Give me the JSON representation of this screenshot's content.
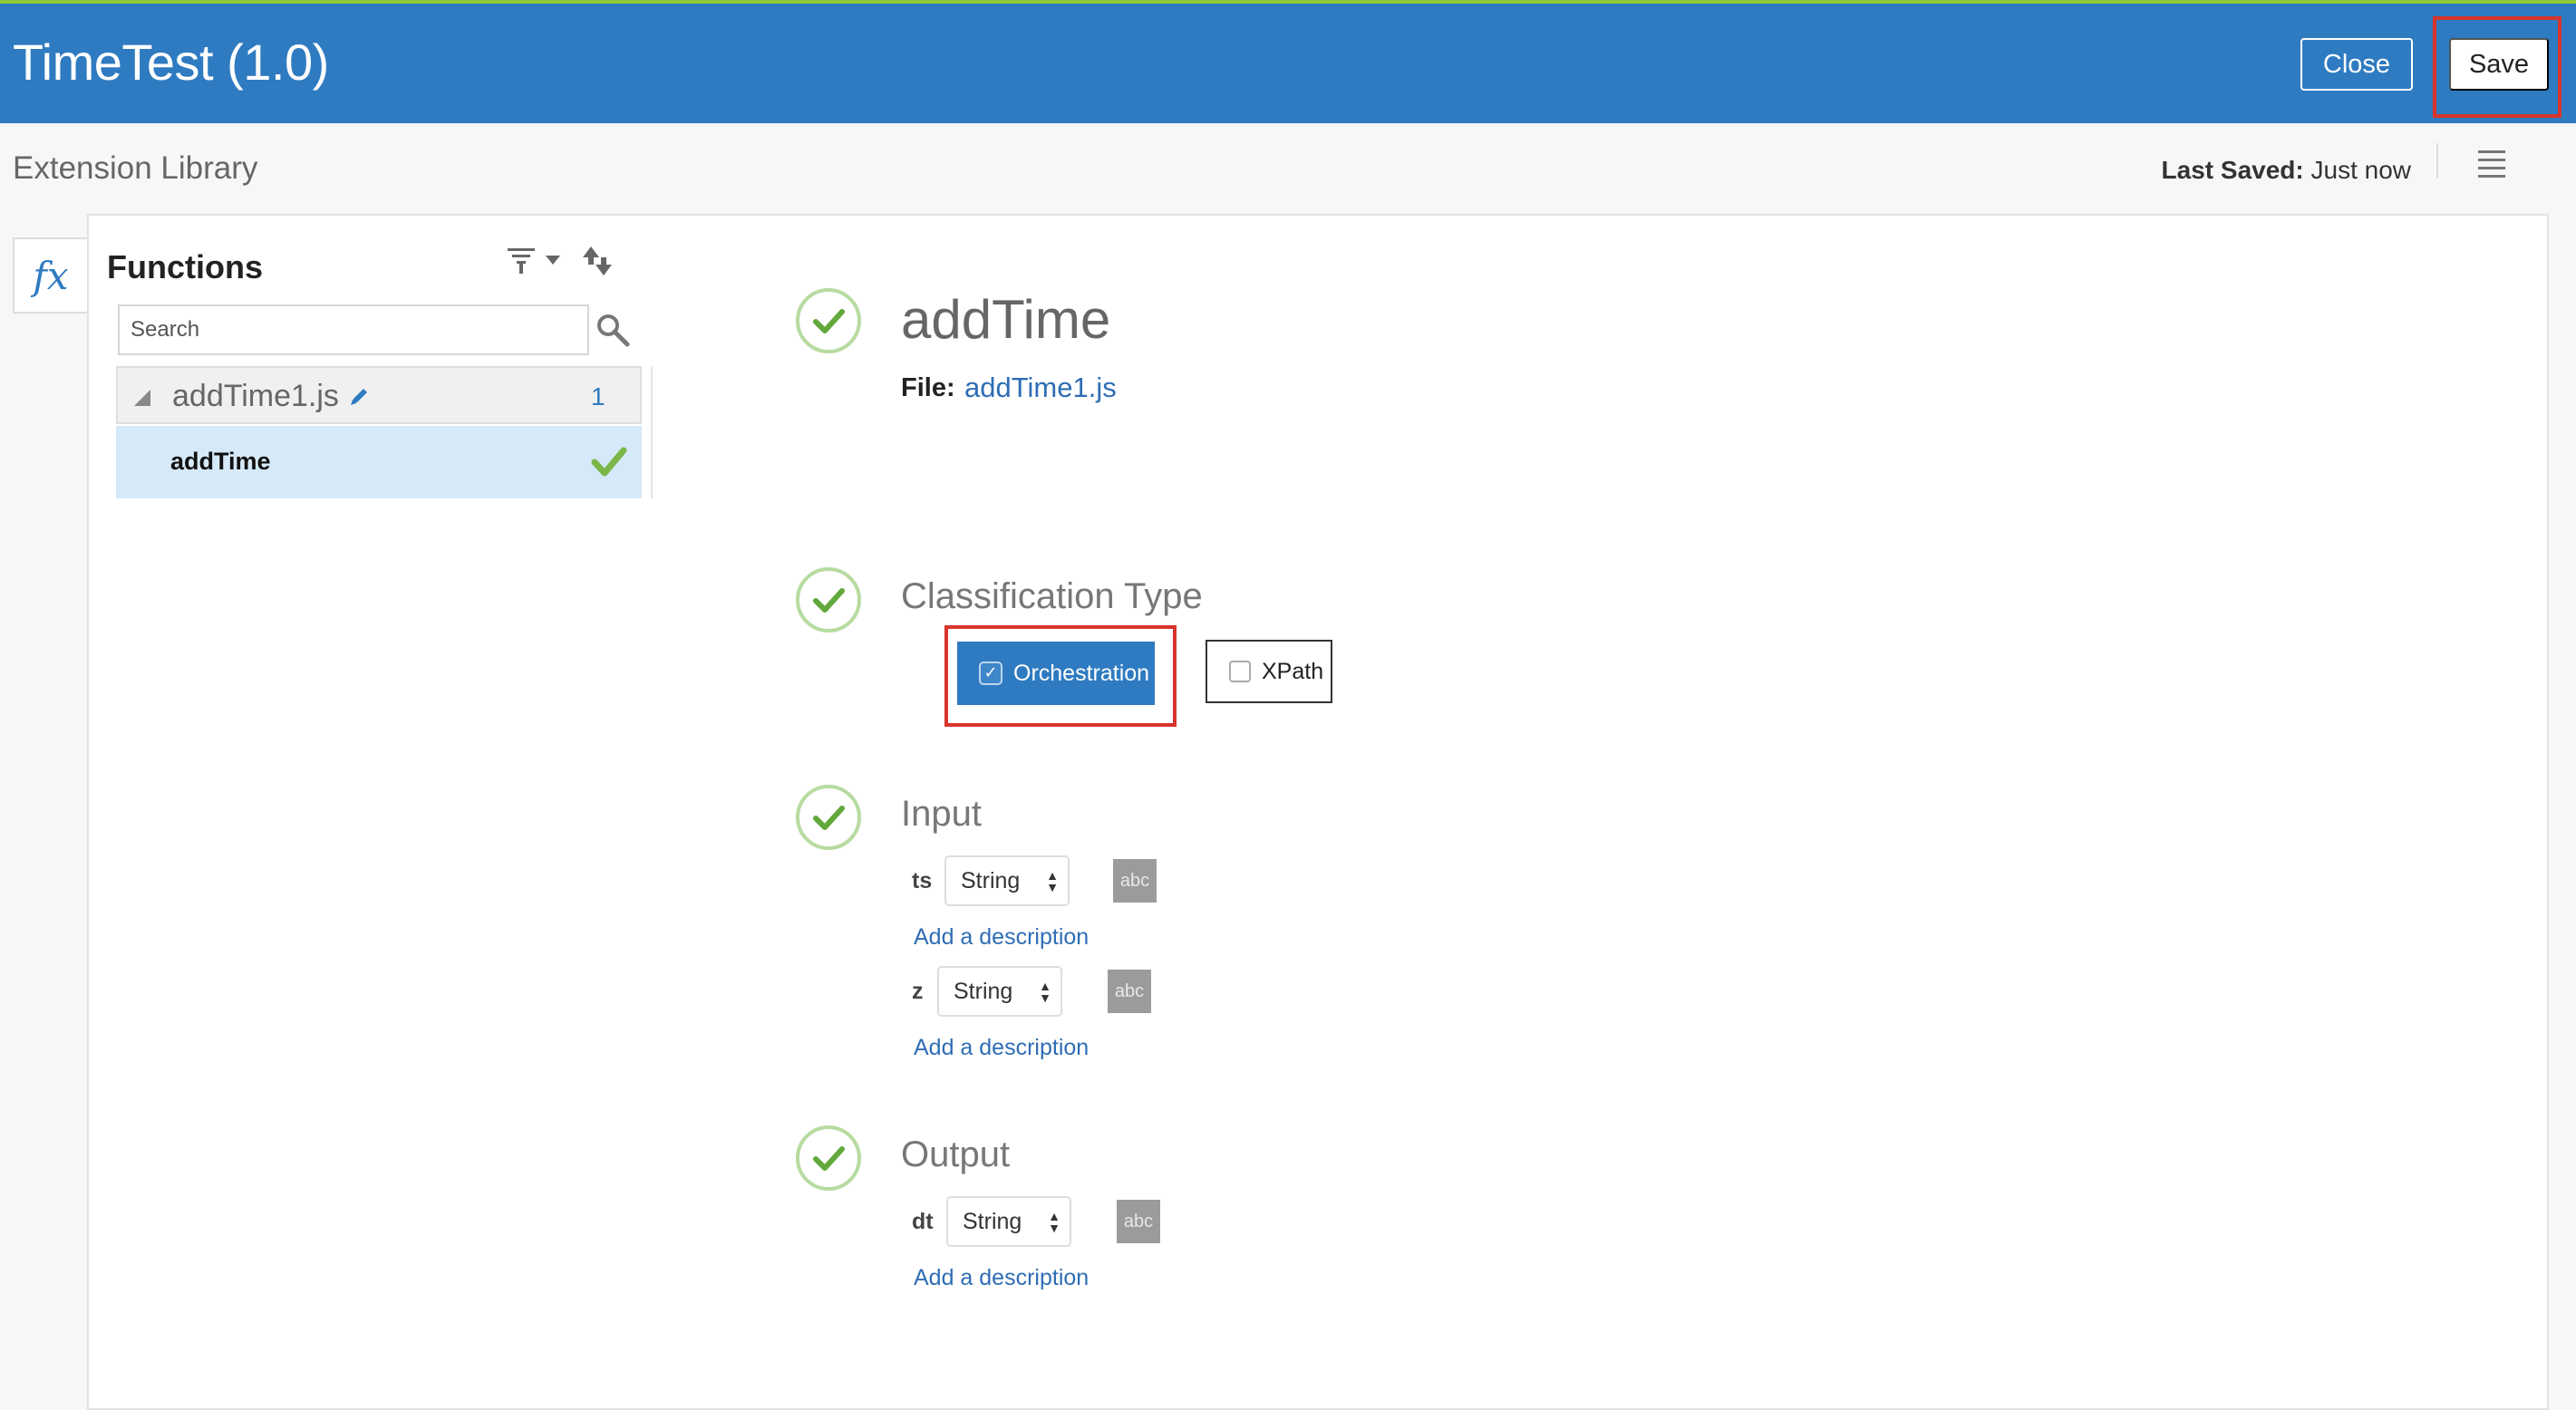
{
  "header": {
    "title": "TimeTest (1.0)",
    "close_label": "Close",
    "save_label": "Save"
  },
  "subheader": {
    "title": "Extension Library",
    "last_saved_label": "Last Saved:",
    "last_saved_value": "Just now"
  },
  "side_tab": {
    "icon_text": "fx"
  },
  "functions_panel": {
    "title": "Functions",
    "search_placeholder": "Search",
    "file": {
      "name": "addTime1.js",
      "count": "1"
    },
    "items": [
      {
        "label": "addTime"
      }
    ]
  },
  "detail": {
    "function_name": "addTime",
    "file_label": "File:",
    "file_link": "addTime1.js",
    "classification": {
      "title": "Classification Type",
      "options": [
        {
          "label": "Orchestration",
          "checked": true
        },
        {
          "label": "XPath",
          "checked": false
        }
      ]
    },
    "input": {
      "title": "Input",
      "params": [
        {
          "name": "ts",
          "type": "String",
          "badge": "abc",
          "description_link": "Add a description"
        },
        {
          "name": "z",
          "type": "String",
          "badge": "abc",
          "description_link": "Add a description"
        }
      ]
    },
    "output": {
      "title": "Output",
      "params": [
        {
          "name": "dt",
          "type": "String",
          "badge": "abc",
          "description_link": "Add a description"
        }
      ]
    }
  },
  "colors": {
    "header_bg": "#2f7bc1",
    "accent_green": "#8fc93a",
    "highlight_red": "#d9342b",
    "link_blue": "#2f6db5",
    "selected_row_bg": "#d6e9f8"
  },
  "icons": [
    "fx-icon",
    "filter-icon",
    "caret-down-icon",
    "sort-icon",
    "search-icon",
    "collapse-triangle-icon",
    "pencil-icon",
    "check-icon",
    "check-circle-icon",
    "hamburger-menu-icon",
    "select-arrows-icon"
  ]
}
